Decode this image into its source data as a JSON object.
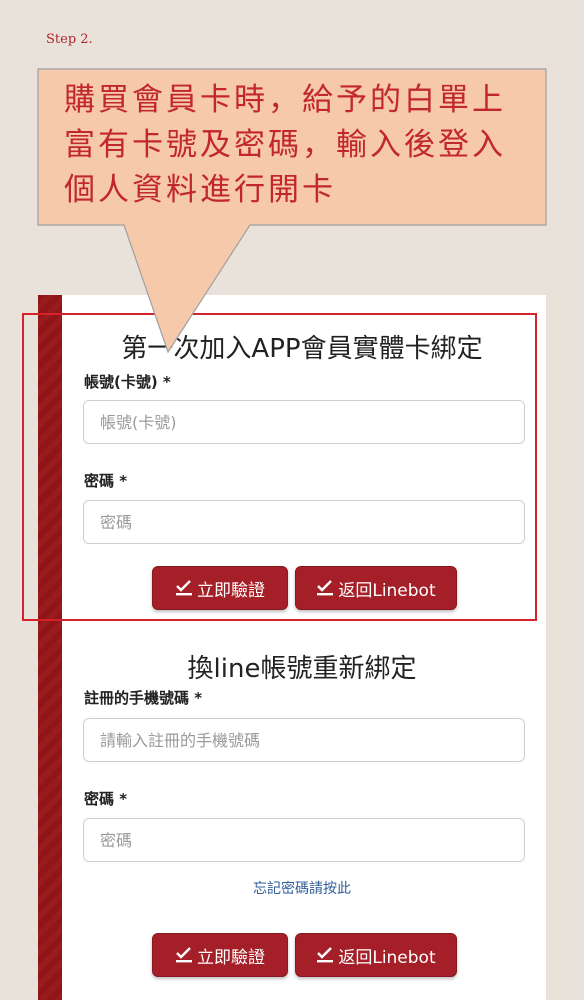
{
  "step_label": "Step 2.",
  "callout": {
    "lines": [
      "購買會員卡時，給予的白單上",
      "富有卡號及密碼，輸入後登入",
      "個人資料進行開卡"
    ]
  },
  "first_bind": {
    "title": "第一次加入APP會員實體卡綁定",
    "account_label": "帳號(卡號) *",
    "account_placeholder": "帳號(卡號)",
    "password_label": "密碼 *",
    "password_placeholder": "密碼",
    "verify_button": "立即驗證",
    "back_button": "返回Linebot"
  },
  "rebind": {
    "title": "換line帳號重新綁定",
    "phone_label": "註冊的手機號碼 *",
    "phone_placeholder": "請輸入註冊的手機號碼",
    "password_label": "密碼 *",
    "password_placeholder": "密碼",
    "forgot_link": "忘記密碼請按此",
    "verify_button": "立即驗證",
    "back_button": "返回Linebot"
  },
  "colors": {
    "accent": "#a41f27",
    "highlight_border": "#d4232b",
    "callout_fill": "#f6c9aa",
    "callout_text": "#c1272d",
    "link": "#2f5d9a"
  },
  "icons": {
    "button": "check-underline-icon"
  }
}
